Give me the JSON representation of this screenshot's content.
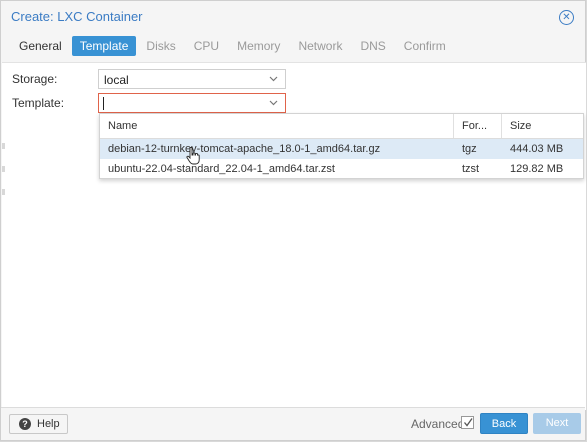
{
  "window": {
    "title": "Create: LXC Container",
    "close_icon": "close-icon"
  },
  "tabs": [
    {
      "label": "General",
      "state": "enabled"
    },
    {
      "label": "Template",
      "state": "active"
    },
    {
      "label": "Disks",
      "state": "disabled"
    },
    {
      "label": "CPU",
      "state": "disabled"
    },
    {
      "label": "Memory",
      "state": "disabled"
    },
    {
      "label": "Network",
      "state": "disabled"
    },
    {
      "label": "DNS",
      "state": "disabled"
    },
    {
      "label": "Confirm",
      "state": "disabled"
    }
  ],
  "form": {
    "storage": {
      "label": "Storage:",
      "value": "local"
    },
    "template": {
      "label": "Template:",
      "value": ""
    }
  },
  "dropdown": {
    "columns": {
      "name": "Name",
      "format": "For...",
      "size": "Size"
    },
    "rows": [
      {
        "name": "debian-12-turnkey-tomcat-apache_18.0-1_amd64.tar.gz",
        "format": "tgz",
        "size": "444.03 MB"
      },
      {
        "name": "ubuntu-22.04-standard_22.04-1_amd64.tar.zst",
        "format": "tzst",
        "size": "129.82 MB"
      }
    ]
  },
  "footer": {
    "help_label": "Help",
    "advanced_label": "Advanced",
    "advanced_checked": true,
    "back_label": "Back",
    "next_label": "Next"
  },
  "colors": {
    "accent": "#3892d4",
    "title": "#3b7cc4",
    "invalid_border": "#e0634a",
    "row_hover": "#ddeaf6"
  }
}
